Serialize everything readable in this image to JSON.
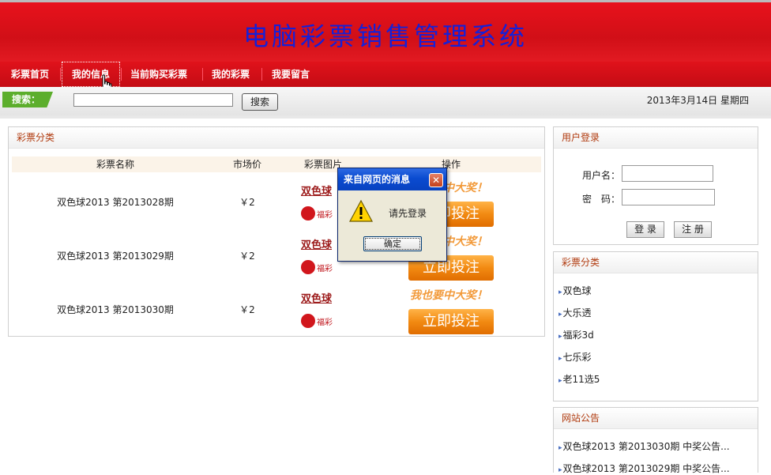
{
  "header": {
    "title": "电脑彩票销售管理系统"
  },
  "nav": {
    "items": [
      {
        "label": "彩票首页"
      },
      {
        "label": "我的信息"
      },
      {
        "label": "当前购买彩票"
      },
      {
        "label": "我的彩票"
      },
      {
        "label": "我要留言"
      }
    ]
  },
  "search": {
    "label": "搜索：",
    "value": "",
    "button": "搜索"
  },
  "date": "2013年3月14日 星期四",
  "main": {
    "title": "彩票分类",
    "columns": [
      "彩票名称",
      "市场价",
      "彩票图片",
      "操作"
    ],
    "rows": [
      {
        "name": "双色球2013 第2013028期",
        "price": "￥2"
      },
      {
        "name": "双色球2013 第2013029期",
        "price": "￥2"
      },
      {
        "name": "双色球2013 第2013030期",
        "price": "￥2"
      }
    ],
    "lotto_title": "双色球",
    "lotto_sub": "福彩",
    "bet_slogan": "我也要中大奖！",
    "bet_button": "立即投注"
  },
  "login": {
    "title": "用户登录",
    "username_label": "用户名：",
    "password_label": "密　码：",
    "login_button": "登 录",
    "register_button": "注 册"
  },
  "categories": {
    "title": "彩票分类",
    "items": [
      "双色球",
      "大乐透",
      "福彩3d",
      "七乐彩",
      "老11选5"
    ]
  },
  "notices": {
    "title": "网站公告",
    "items": [
      "双色球2013 第2013030期 中奖公告...",
      "双色球2013 第2013029期 中奖公告..."
    ]
  },
  "dialog": {
    "title": "来自网页的消息",
    "message": "请先登录",
    "ok": "确定",
    "close": "✕"
  }
}
